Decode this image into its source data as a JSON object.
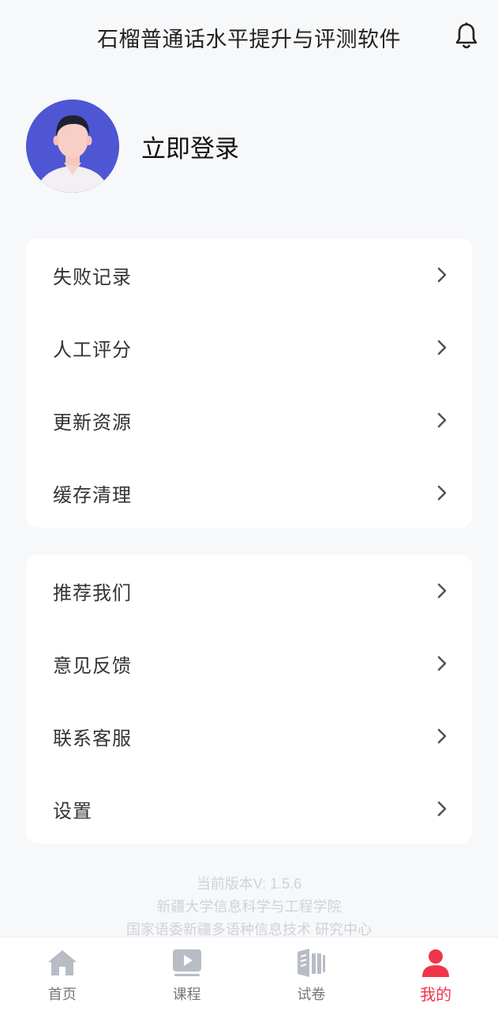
{
  "header": {
    "title": "石榴普通话水平提升与评测软件",
    "bell_icon": "bell-icon"
  },
  "profile": {
    "avatar_icon": "user-avatar",
    "login_label": "立即登录"
  },
  "menu_group_1": {
    "items": [
      {
        "label": "失败记录",
        "icon": "chevron-right-icon"
      },
      {
        "label": "人工评分",
        "icon": "chevron-right-icon"
      },
      {
        "label": "更新资源",
        "icon": "chevron-right-icon"
      },
      {
        "label": "缓存清理",
        "icon": "chevron-right-icon"
      }
    ]
  },
  "menu_group_2": {
    "items": [
      {
        "label": "推荐我们",
        "icon": "chevron-right-icon"
      },
      {
        "label": "意见反馈",
        "icon": "chevron-right-icon"
      },
      {
        "label": "联系客服",
        "icon": "chevron-right-icon"
      },
      {
        "label": "设置",
        "icon": "chevron-right-icon"
      }
    ]
  },
  "footer": {
    "version": "当前版本V:  1.5.6",
    "org_line1": "新疆大学信息科学与工程学院",
    "org_line2": "国家语委新疆多语种信息技术 研究中心"
  },
  "tabbar": {
    "tabs": [
      {
        "label": "首页",
        "icon": "home-icon",
        "active": false
      },
      {
        "label": "课程",
        "icon": "play-video-icon",
        "active": false
      },
      {
        "label": "试卷",
        "icon": "book-icon",
        "active": false
      },
      {
        "label": "我的",
        "icon": "person-icon",
        "active": true
      }
    ]
  },
  "colors": {
    "accent": "#f0354b",
    "avatar_bg": "#4e56d3",
    "page_bg": "#f7f8fa",
    "inactive_icon": "#b8bcc4"
  }
}
